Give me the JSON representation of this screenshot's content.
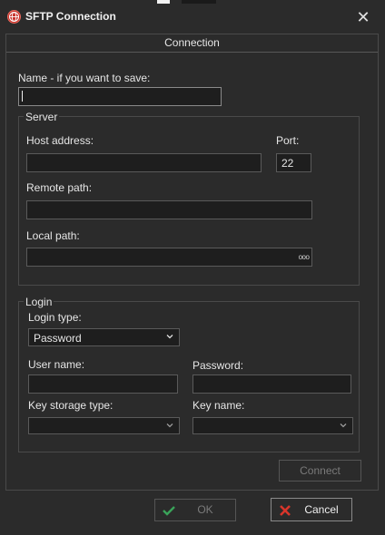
{
  "window": {
    "title": "SFTP Connection",
    "close_glyph": "✕",
    "icon": "globe-icon"
  },
  "tab": {
    "label": "Connection"
  },
  "name_field": {
    "label": "Name - if you want to save:",
    "value": ""
  },
  "server": {
    "legend": "Server",
    "host_label": "Host address:",
    "host_value": "",
    "port_label": "Port:",
    "port_value": "22",
    "remote_label": "Remote path:",
    "remote_value": "",
    "local_label": "Local path:",
    "local_value": "",
    "browse_glyph": "ooo"
  },
  "login": {
    "legend": "Login",
    "type_label": "Login type:",
    "type_value": "Password",
    "user_label": "User name:",
    "user_value": "",
    "password_label": "Password:",
    "password_value": "",
    "key_storage_label": "Key storage type:",
    "key_storage_value": "",
    "key_name_label": "Key name:",
    "key_name_value": ""
  },
  "buttons": {
    "connect": "Connect",
    "ok": "OK",
    "cancel": "Cancel"
  },
  "colors": {
    "background": "#2b2b2b",
    "field": "#1e1e1e",
    "ok_check": "#3aa35a",
    "cancel_x": "#d9352b",
    "app_icon": "#c7322b"
  }
}
